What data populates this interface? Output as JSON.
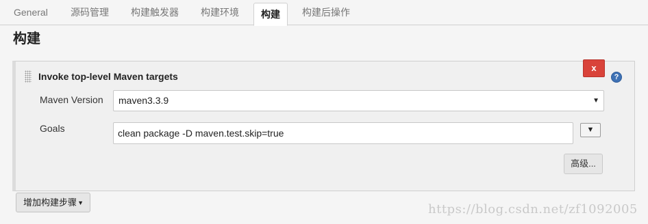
{
  "tabs": [
    {
      "label": "General",
      "active": false
    },
    {
      "label": "源码管理",
      "active": false
    },
    {
      "label": "构建触发器",
      "active": false
    },
    {
      "label": "构建环境",
      "active": false
    },
    {
      "label": "构建",
      "active": true
    },
    {
      "label": "构建后操作",
      "active": false
    }
  ],
  "section": {
    "title": "构建"
  },
  "step": {
    "title": "Invoke top-level Maven targets",
    "delete_label": "x",
    "help_label": "?",
    "maven_version": {
      "label": "Maven Version",
      "value": "maven3.3.9"
    },
    "goals": {
      "label": "Goals",
      "value": "clean package -D maven.test.skip=true"
    },
    "advanced_label": "高级..."
  },
  "add_step": {
    "label": "增加构建步骤"
  },
  "watermark": "https://blog.csdn.net/zf1092005",
  "colors": {
    "delete": "#d9433a",
    "help": "#3f72b5"
  }
}
